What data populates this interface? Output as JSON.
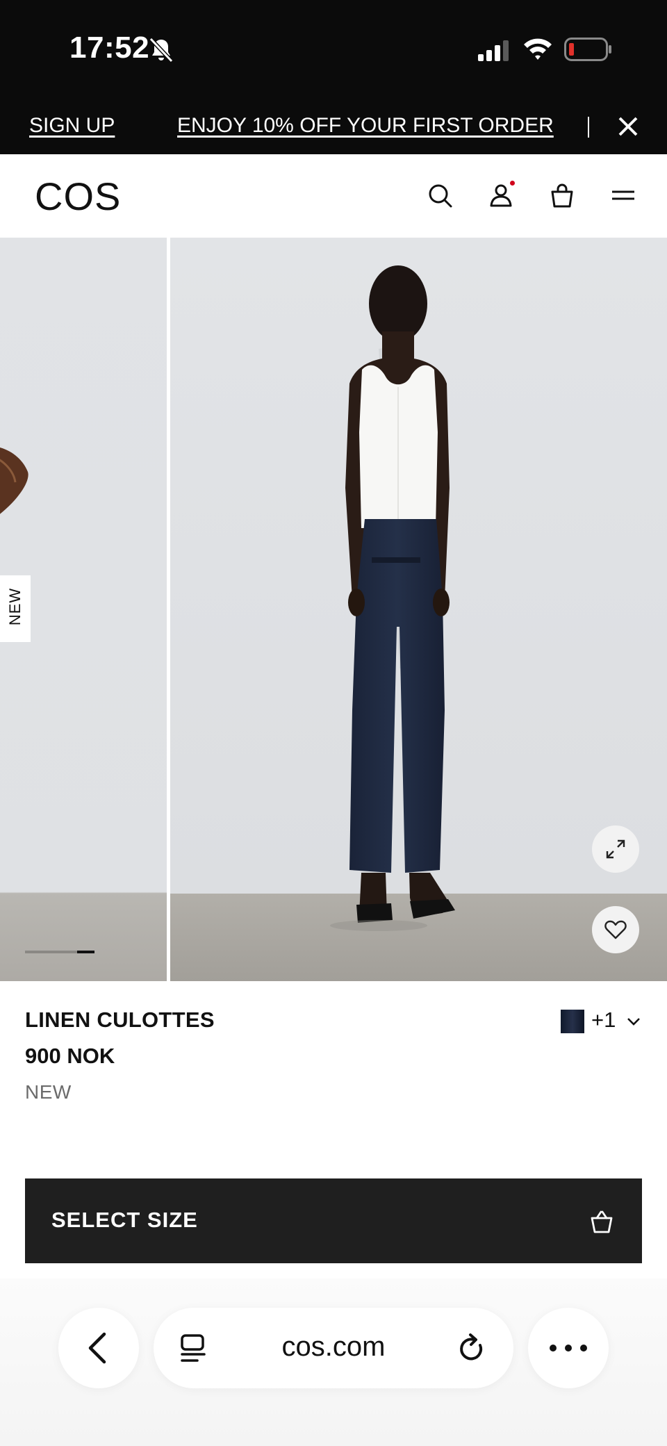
{
  "status_bar": {
    "time": "17:52",
    "icons": [
      "bell-slash-icon",
      "cellular-signal-icon",
      "wifi-icon",
      "battery-low-icon"
    ]
  },
  "promo": {
    "signup_label": "SIGN UP",
    "offer_label": "ENJOY 10% OFF YOUR FIRST ORDER",
    "close_icon": "close-icon"
  },
  "header": {
    "logo": "COS",
    "icons": [
      "search-icon",
      "account-icon",
      "shopping-bag-icon",
      "menu-icon"
    ],
    "account_notification_color": "#d0021b"
  },
  "gallery": {
    "badge": "NEW",
    "active_slide_fraction": 0.5,
    "buttons": [
      "expand-icon",
      "heart-icon"
    ]
  },
  "product": {
    "name": "LINEN CULOTTES",
    "price": "900 NOK",
    "badge": "NEW",
    "swatch_color": "#1a2236",
    "more_colors": "+1"
  },
  "cta": {
    "select_size_label": "SELECT SIZE",
    "button_color": "#1f1f1f"
  },
  "browser": {
    "url": "cos.com",
    "icons": [
      "back-chevron-icon",
      "tabs-icon",
      "reload-icon",
      "more-icon"
    ]
  }
}
